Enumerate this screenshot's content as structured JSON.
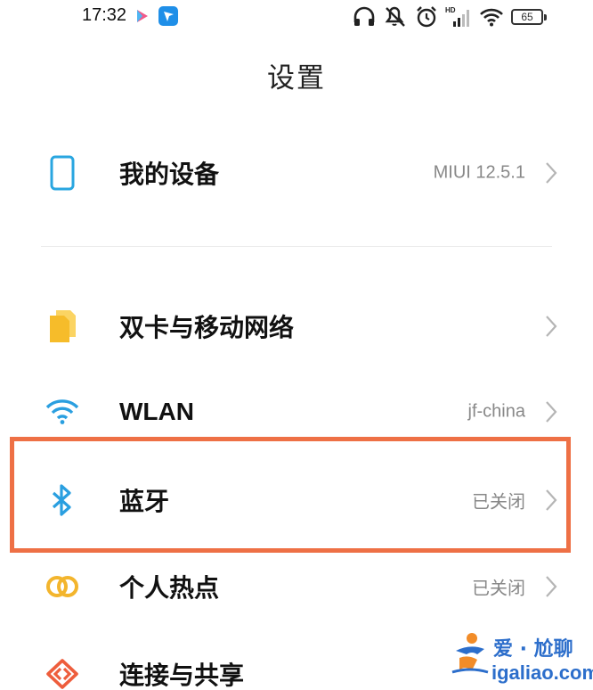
{
  "status_bar": {
    "time": "17:32",
    "battery": "65",
    "icons": [
      "headphones-icon",
      "mute-icon",
      "alarm-icon",
      "hd-signal-icon",
      "wifi-icon",
      "battery-icon"
    ]
  },
  "page": {
    "title": "设置"
  },
  "settings": [
    {
      "label": "我的设备",
      "value": "MIUI 12.5.1",
      "icon": "phone-device-icon",
      "icon_color": "#29a6e0"
    },
    {
      "label": "双卡与移动网络",
      "value": "",
      "icon": "sim-card-icon",
      "icon_color": "#f6bc2a"
    },
    {
      "label": "WLAN",
      "value": "jf-china",
      "icon": "wifi-icon",
      "icon_color": "#2a9fe0"
    },
    {
      "label": "蓝牙",
      "value": "已关闭",
      "icon": "bluetooth-icon",
      "icon_color": "#2a9fe0"
    },
    {
      "label": "个人热点",
      "value": "已关闭",
      "icon": "hotspot-icon",
      "icon_color": "#f3b52d"
    },
    {
      "label": "连接与共享",
      "value": "",
      "icon": "connection-share-icon",
      "icon_color": "#ee5d3c"
    }
  ],
  "highlight_color": "#ee7045",
  "watermark": {
    "top_text": "爱 · 尬聊",
    "bottom_text": "igaliao.com",
    "color": "#2c6ecb"
  }
}
